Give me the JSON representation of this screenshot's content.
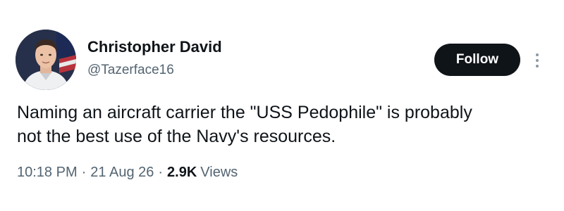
{
  "author": {
    "display_name": "Christopher David",
    "handle": "@Tazerface16"
  },
  "actions": {
    "follow_label": "Follow",
    "more_icon": "more-vertical-icon"
  },
  "tweet": {
    "line1": "Naming an aircraft carrier the \"USS Pedophile\" is probably",
    "line2": "not the best use of the Navy's resources."
  },
  "meta": {
    "time": "10:18 PM",
    "date": "21 Aug 26",
    "separator": "·",
    "views_count": "2.9K",
    "views_label": "Views"
  },
  "colors": {
    "primary_text": "#0f1419",
    "secondary_text": "#536471",
    "follow_bg": "#0f1419",
    "follow_text": "#ffffff"
  }
}
